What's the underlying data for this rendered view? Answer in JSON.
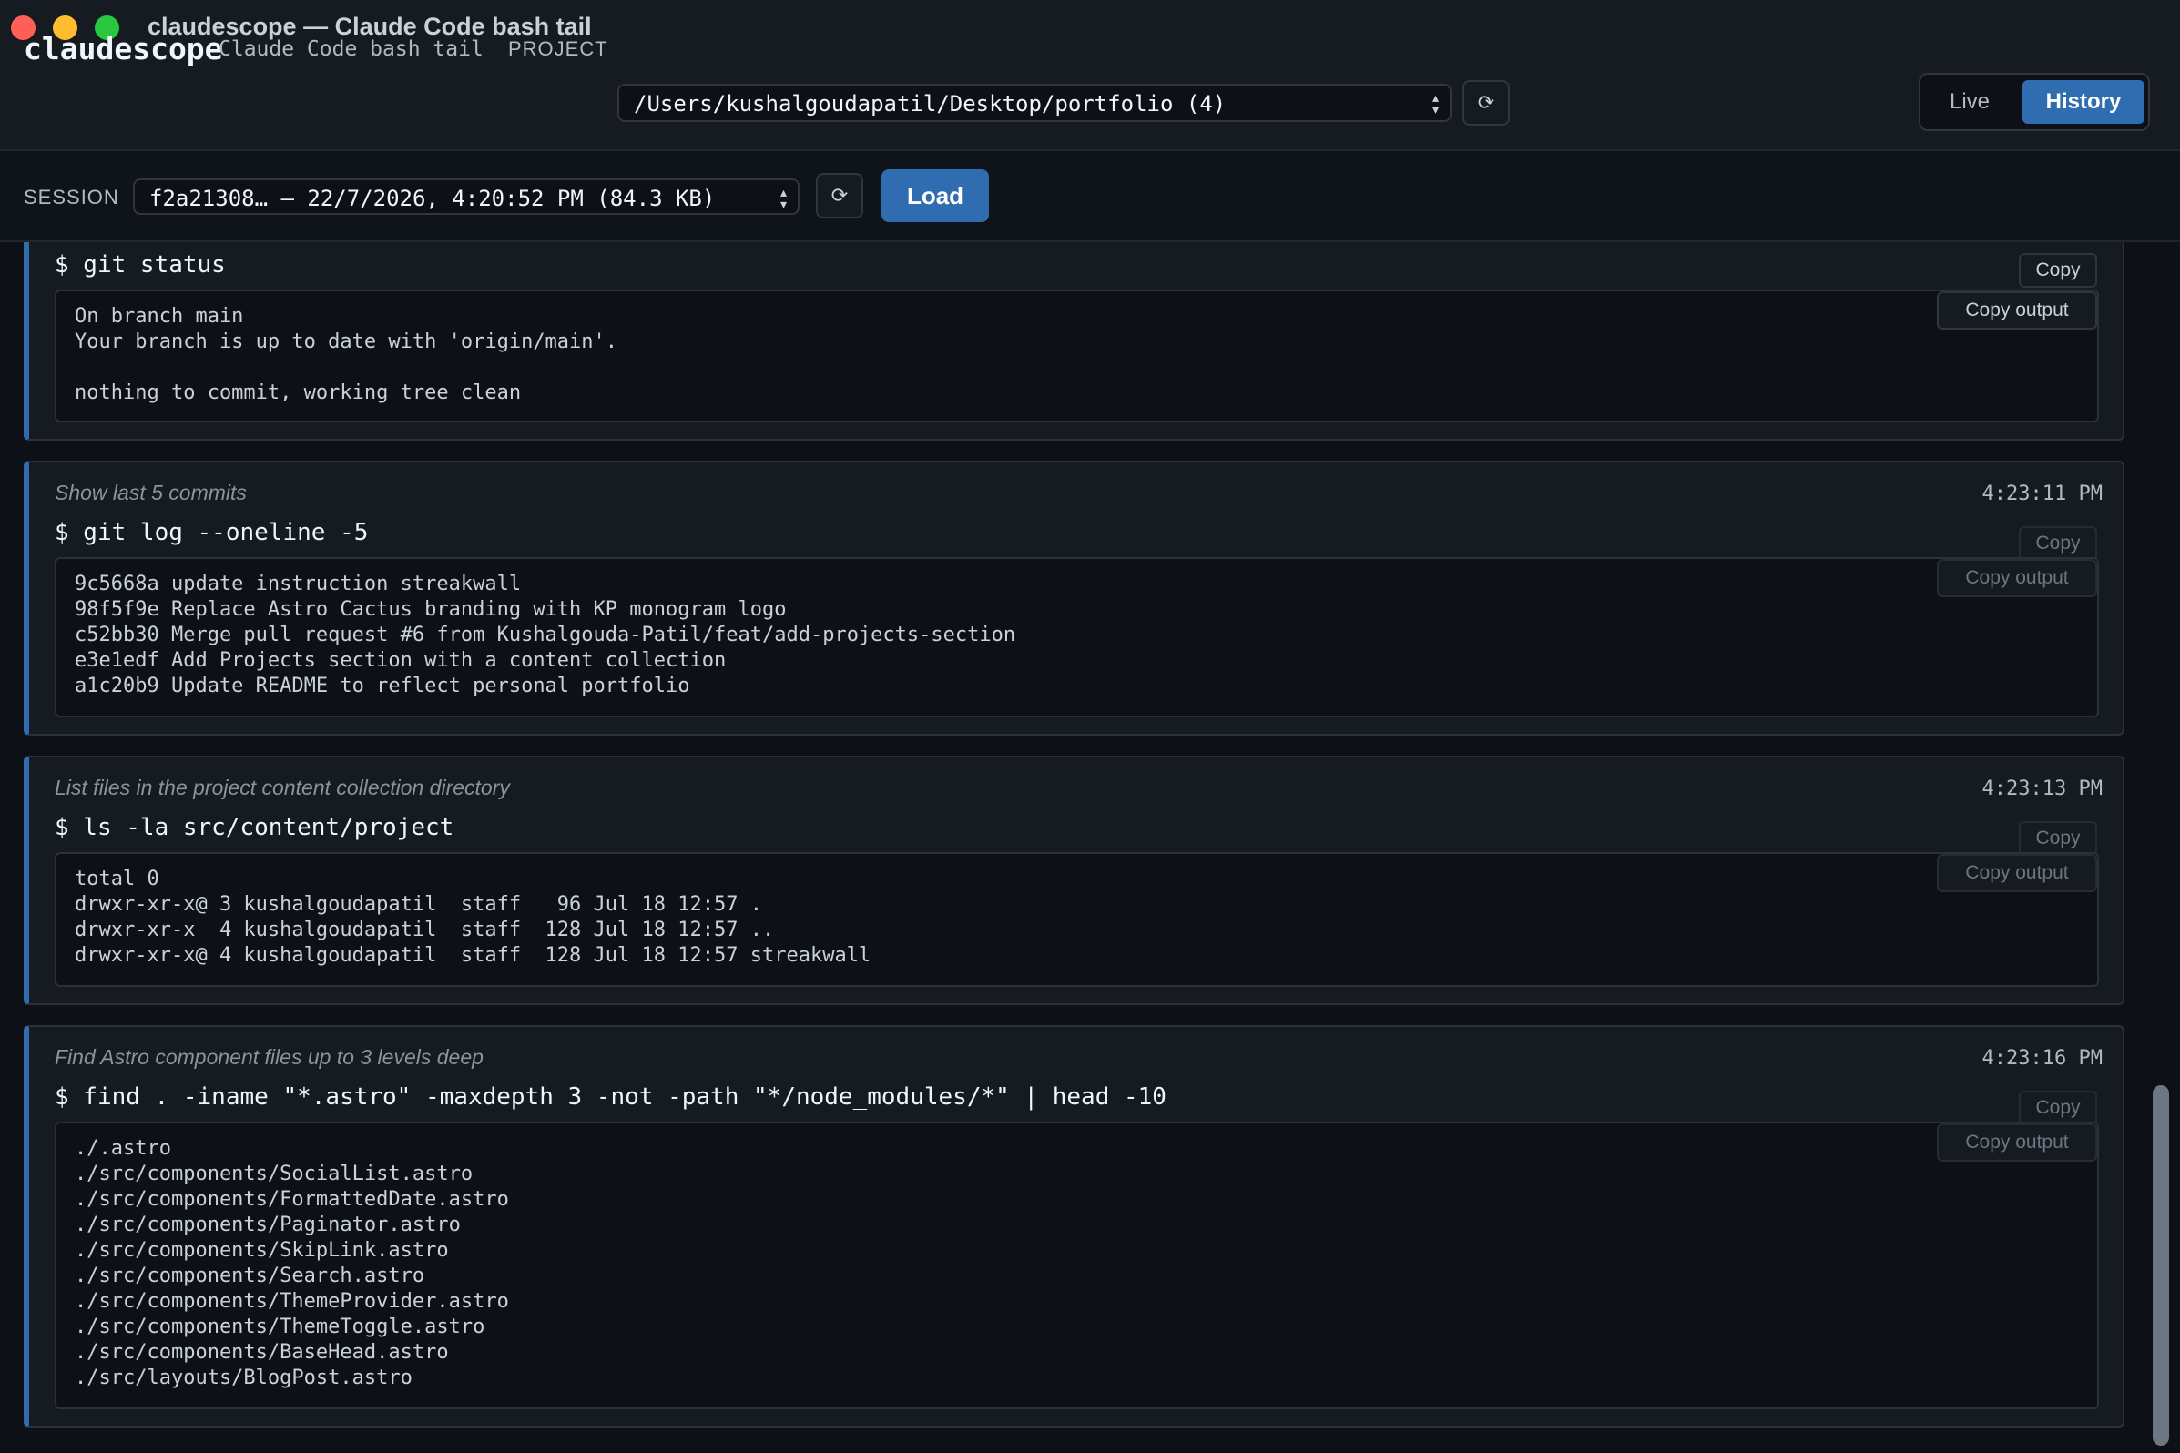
{
  "window": {
    "title": "claudescope — Claude Code bash tail"
  },
  "header": {
    "brand": "claudescope",
    "subtitle": "Claude Code bash tail",
    "project_label": "PROJECT",
    "project_value": "/Users/kushalgoudapatil/Desktop/portfolio (4)",
    "refresh_glyph": "⟳",
    "mode_tabs": {
      "live": "Live",
      "history": "History",
      "active": "History"
    }
  },
  "session_bar": {
    "label": "SESSION",
    "value": "f2a21308… — 22/7/2026, 4:20:52 PM (84.3 KB)",
    "refresh_glyph": "⟳",
    "load_label": "Load"
  },
  "entries": [
    {
      "description": "",
      "time": "",
      "command": "$ git status",
      "copy_label": "Copy",
      "copy_output_label": "Copy output",
      "output": "On branch main\nYour branch is up to date with 'origin/main'.\n\nnothing to commit, working tree clean"
    },
    {
      "description": "Show last 5 commits",
      "time": "4:23:11 PM",
      "command": "$ git log --oneline -5",
      "copy_label": "Copy",
      "copy_output_label": "Copy output",
      "output": "9c5668a update instruction streakwall\n98f5f9e Replace Astro Cactus branding with KP monogram logo\nc52bb30 Merge pull request #6 from Kushalgouda-Patil/feat/add-projects-section\ne3e1edf Add Projects section with a content collection\na1c20b9 Update README to reflect personal portfolio"
    },
    {
      "description": "List files in the project content collection directory",
      "time": "4:23:13 PM",
      "command": "$ ls -la src/content/project",
      "copy_label": "Copy",
      "copy_output_label": "Copy output",
      "output": "total 0\ndrwxr-xr-x@ 3 kushalgoudapatil  staff   96 Jul 18 12:57 .\ndrwxr-xr-x  4 kushalgoudapatil  staff  128 Jul 18 12:57 ..\ndrwxr-xr-x@ 4 kushalgoudapatil  staff  128 Jul 18 12:57 streakwall"
    },
    {
      "description": "Find Astro component files up to 3 levels deep",
      "time": "4:23:16 PM",
      "command": "$ find . -iname \"*.astro\" -maxdepth 3 -not -path \"*/node_modules/*\" | head -10",
      "copy_label": "Copy",
      "copy_output_label": "Copy output",
      "output": "./.astro\n./src/components/SocialList.astro\n./src/components/FormattedDate.astro\n./src/components/Paginator.astro\n./src/components/SkipLink.astro\n./src/components/Search.astro\n./src/components/ThemeProvider.astro\n./src/components/ThemeToggle.astro\n./src/components/BaseHead.astro\n./src/layouts/BlogPost.astro"
    }
  ],
  "colors": {
    "accent": "#2f6db0",
    "background": "#0d1117",
    "panel": "#161b22"
  }
}
